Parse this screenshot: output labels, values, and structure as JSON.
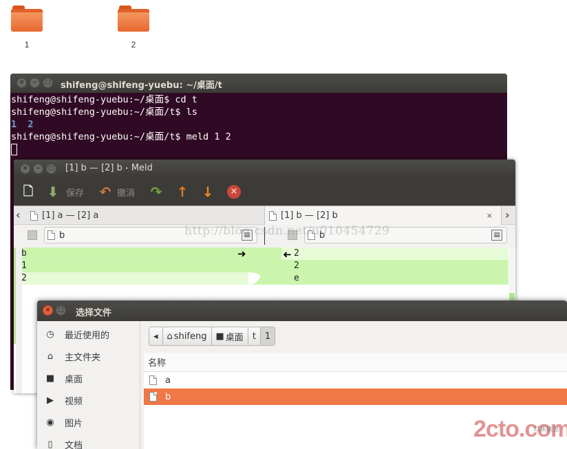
{
  "desktop": {
    "icons": [
      {
        "label": "1"
      },
      {
        "label": "2"
      }
    ]
  },
  "terminal": {
    "title": "shifeng@shifeng-yuebu: ~/桌面/t",
    "lines": [
      "shifeng@shifeng-yuebu:~/桌面$ cd t",
      "shifeng@shifeng-yuebu:~/桌面/t$ ls",
      "1  2",
      "shifeng@shifeng-yuebu:~/桌面/t$ meld 1 2"
    ]
  },
  "meld": {
    "title": "[1] b — [2] b - Meld",
    "toolbar": {
      "save_label": "保存",
      "undo_label": "撤消"
    },
    "tabs": [
      {
        "label": "[1] a — [2] a",
        "close": "×"
      },
      {
        "label": "[1] b — [2] b",
        "close": "×"
      }
    ],
    "left_file": "b",
    "right_file": "b",
    "left_lines": [
      "b",
      "1",
      "2"
    ],
    "right_lines": [
      "2",
      "2",
      "e"
    ],
    "colors": {
      "insert": "#c8f5a8",
      "insert_light": "#e2fad0"
    }
  },
  "chooser": {
    "title": "选择文件",
    "places": [
      {
        "label": "最近使用的",
        "icon": "clock-icon"
      },
      {
        "label": "主文件夹",
        "icon": "home-icon"
      },
      {
        "label": "桌面",
        "icon": "folder-icon"
      },
      {
        "label": "视频",
        "icon": "video-icon"
      },
      {
        "label": "图片",
        "icon": "camera-icon"
      },
      {
        "label": "文档",
        "icon": "document-icon"
      }
    ],
    "path": [
      "shifeng",
      "桌面",
      "t",
      "1"
    ],
    "column_header": "名称",
    "files": [
      {
        "name": "a",
        "selected": false
      },
      {
        "name": "b",
        "selected": true
      }
    ],
    "accent": "#f07746"
  },
  "watermark": "http://blog.csdn.net/u010454729",
  "logo": {
    "main": "2cto.com",
    "sub": "红黑联盟"
  }
}
